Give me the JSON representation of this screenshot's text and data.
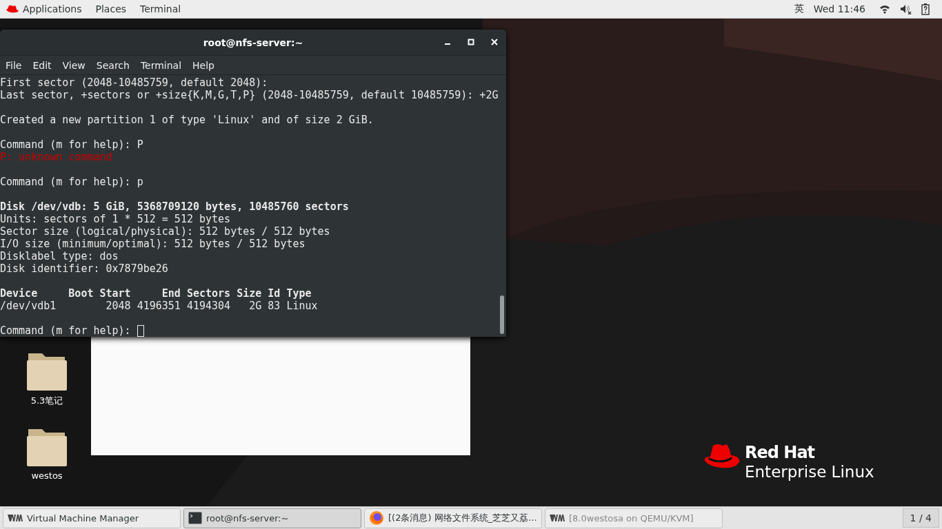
{
  "top_bar": {
    "menus": [
      "Applications",
      "Places",
      "Terminal"
    ],
    "input_method": "英",
    "clock": "Wed 11:46"
  },
  "terminal": {
    "title": "root@nfs-server:~",
    "menu": [
      "File",
      "Edit",
      "View",
      "Search",
      "Terminal",
      "Help"
    ],
    "lines": [
      {
        "kind": "normal",
        "text": "First sector (2048-10485759, default 2048):"
      },
      {
        "kind": "normal",
        "text": "Last sector, +sectors or +size{K,M,G,T,P} (2048-10485759, default 10485759): +2G"
      },
      {
        "kind": "blank"
      },
      {
        "kind": "normal",
        "text": "Created a new partition 1 of type 'Linux' and of size 2 GiB."
      },
      {
        "kind": "blank"
      },
      {
        "kind": "normal",
        "text": "Command (m for help): P"
      },
      {
        "kind": "error",
        "text": "P: unknown command"
      },
      {
        "kind": "blank"
      },
      {
        "kind": "normal",
        "text": "Command (m for help): p"
      },
      {
        "kind": "blank"
      },
      {
        "kind": "bold",
        "text": "Disk /dev/vdb: 5 GiB, 5368709120 bytes, 10485760 sectors"
      },
      {
        "kind": "normal",
        "text": "Units: sectors of 1 * 512 = 512 bytes"
      },
      {
        "kind": "normal",
        "text": "Sector size (logical/physical): 512 bytes / 512 bytes"
      },
      {
        "kind": "normal",
        "text": "I/O size (minimum/optimal): 512 bytes / 512 bytes"
      },
      {
        "kind": "normal",
        "text": "Disklabel type: dos"
      },
      {
        "kind": "normal",
        "text": "Disk identifier: 0x7879be26"
      },
      {
        "kind": "blank"
      },
      {
        "kind": "bold",
        "text": "Device     Boot Start     End Sectors Size Id Type"
      },
      {
        "kind": "normal",
        "text": "/dev/vdb1        2048 4196351 4194304   2G 83 Linux"
      },
      {
        "kind": "blank"
      },
      {
        "kind": "prompt",
        "text": "Command (m for help): "
      }
    ]
  },
  "desktop_icons": [
    {
      "label": "5.3笔记"
    },
    {
      "label": "westos"
    }
  ],
  "logo": {
    "line_1": "Red Hat",
    "line_2": "Enterprise Linux"
  },
  "taskbar": {
    "tasks": [
      {
        "kind": "vm",
        "label": "Virtual Machine Manager",
        "selected": false,
        "disabled": false
      },
      {
        "kind": "terminal",
        "label": "root@nfs-server:~",
        "selected": true,
        "disabled": false
      },
      {
        "kind": "browser",
        "label": "[(2条消息) 网络文件系统_芝芝又荔...",
        "selected": false,
        "disabled": false
      },
      {
        "kind": "vm",
        "label": "[8.0westosa on QEMU/KVM]",
        "selected": false,
        "disabled": true
      }
    ],
    "workspace": "1 / 4"
  }
}
